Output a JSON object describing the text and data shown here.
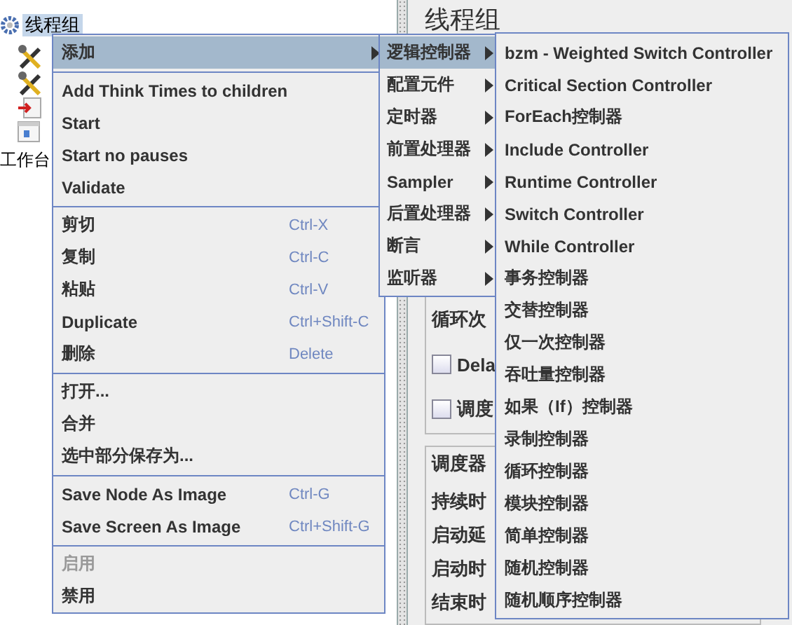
{
  "tree": {
    "items": [
      {
        "label": "线程组",
        "selected": true,
        "kind": "thread-group"
      },
      {
        "label": "工作台",
        "selected": false
      }
    ]
  },
  "panel": {
    "title": "线程组",
    "group_1": {
      "rows": [
        {
          "kind": "label",
          "text": "循环次"
        },
        {
          "kind": "checkbox",
          "text": "Dela",
          "checked": false
        },
        {
          "kind": "checkbox",
          "text": "调度",
          "checked": false
        }
      ]
    },
    "group_2": {
      "title": "调度器",
      "rows": [
        "持续时",
        "启动延",
        "启动时",
        "结束时"
      ]
    }
  },
  "context_menu": {
    "sections": [
      [
        {
          "label": "添加",
          "selected": true,
          "submenu": true
        }
      ],
      [
        {
          "label": "Add Think Times to children"
        },
        {
          "label": "Start"
        },
        {
          "label": "Start no pauses"
        },
        {
          "label": "Validate"
        }
      ],
      [
        {
          "label": "剪切",
          "shortcut": "Ctrl-X"
        },
        {
          "label": "复制",
          "shortcut": "Ctrl-C"
        },
        {
          "label": "粘贴",
          "shortcut": "Ctrl-V"
        },
        {
          "label": "Duplicate",
          "shortcut": "Ctrl+Shift-C"
        },
        {
          "label": "删除",
          "shortcut": "Delete"
        }
      ],
      [
        {
          "label": "打开..."
        },
        {
          "label": "合并"
        },
        {
          "label": "选中部分保存为..."
        }
      ],
      [
        {
          "label": "Save Node As Image",
          "shortcut": "Ctrl-G"
        },
        {
          "label": "Save Screen As Image",
          "shortcut": "Ctrl+Shift-G"
        }
      ],
      [
        {
          "label": "启用",
          "disabled": true
        },
        {
          "label": "禁用",
          "disabled": false
        }
      ]
    ]
  },
  "submenu": {
    "items": [
      {
        "label": "逻辑控制器",
        "selected": true
      },
      {
        "label": "配置元件",
        "selected": false
      },
      {
        "label": "定时器",
        "selected": false
      },
      {
        "label": "前置处理器",
        "selected": false
      },
      {
        "label": "Sampler",
        "selected": false
      },
      {
        "label": "后置处理器",
        "selected": false
      },
      {
        "label": "断言",
        "selected": false
      },
      {
        "label": "监听器",
        "selected": false
      }
    ]
  },
  "submenu_2": {
    "items": [
      {
        "label": "bzm - Weighted Switch Controller"
      },
      {
        "label": "Critical Section Controller"
      },
      {
        "label": "ForEach控制器"
      },
      {
        "label": "Include Controller"
      },
      {
        "label": "Runtime Controller"
      },
      {
        "label": "Switch Controller"
      },
      {
        "label": "While Controller"
      },
      {
        "label": "事务控制器"
      },
      {
        "label": "交替控制器"
      },
      {
        "label": "仅一次控制器"
      },
      {
        "label": "吞吐量控制器"
      },
      {
        "label": "如果（If）控制器"
      },
      {
        "label": "录制控制器"
      },
      {
        "label": "循环控制器"
      },
      {
        "label": "模块控制器"
      },
      {
        "label": "简单控制器"
      },
      {
        "label": "随机控制器"
      },
      {
        "label": "随机顺序控制器"
      }
    ]
  }
}
